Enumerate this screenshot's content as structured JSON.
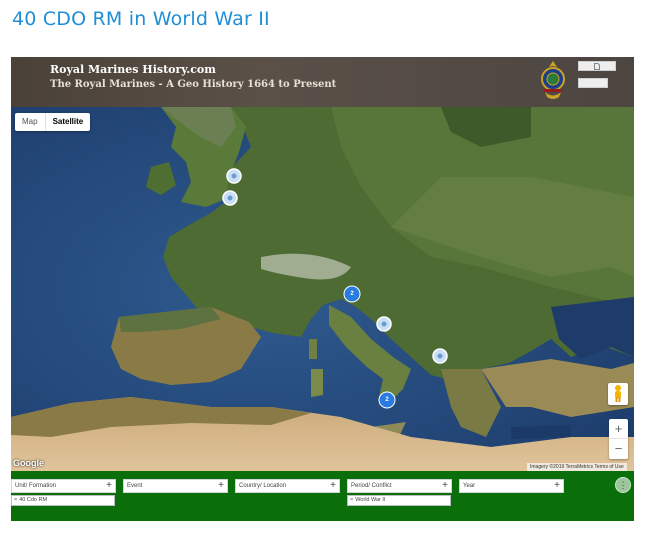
{
  "page": {
    "title": "40 CDO RM in World War II"
  },
  "header": {
    "site_name": "Royal Marines History.com",
    "subtitle": "The Royal Marines - A Geo History 1664 to Present",
    "crest_icon": "royal-marines-crest",
    "button_icon": "document-icon"
  },
  "map": {
    "type_controls": {
      "map_label": "Map",
      "satellite_label": "Satellite",
      "selected": "Satellite"
    },
    "zoom_in_label": "+",
    "zoom_out_label": "−",
    "google_label": "Google",
    "attribution": "Imagery ©2019 TerraMetrics   Terms of Use",
    "cluster_marker_labels": [
      "2",
      "2"
    ],
    "colors": {
      "cluster": "#2a7be0",
      "marker": "#c9dff5",
      "pegman": "#f4b400"
    }
  },
  "filters": {
    "items": [
      {
        "label": "Unit/ Formation",
        "plus": "+",
        "chip": "40 Cdo RM"
      },
      {
        "label": "Event",
        "plus": "+",
        "chip": ""
      },
      {
        "label": "Country/ Location",
        "plus": "+",
        "chip": ""
      },
      {
        "label": "Period/ Conflict",
        "plus": "+",
        "chip": "World War II"
      },
      {
        "label": "Year",
        "plus": "+",
        "chip": ""
      }
    ],
    "chip_remove_icon": "×",
    "more_icon": "⋮",
    "bar_color": "#0a6f0a"
  }
}
